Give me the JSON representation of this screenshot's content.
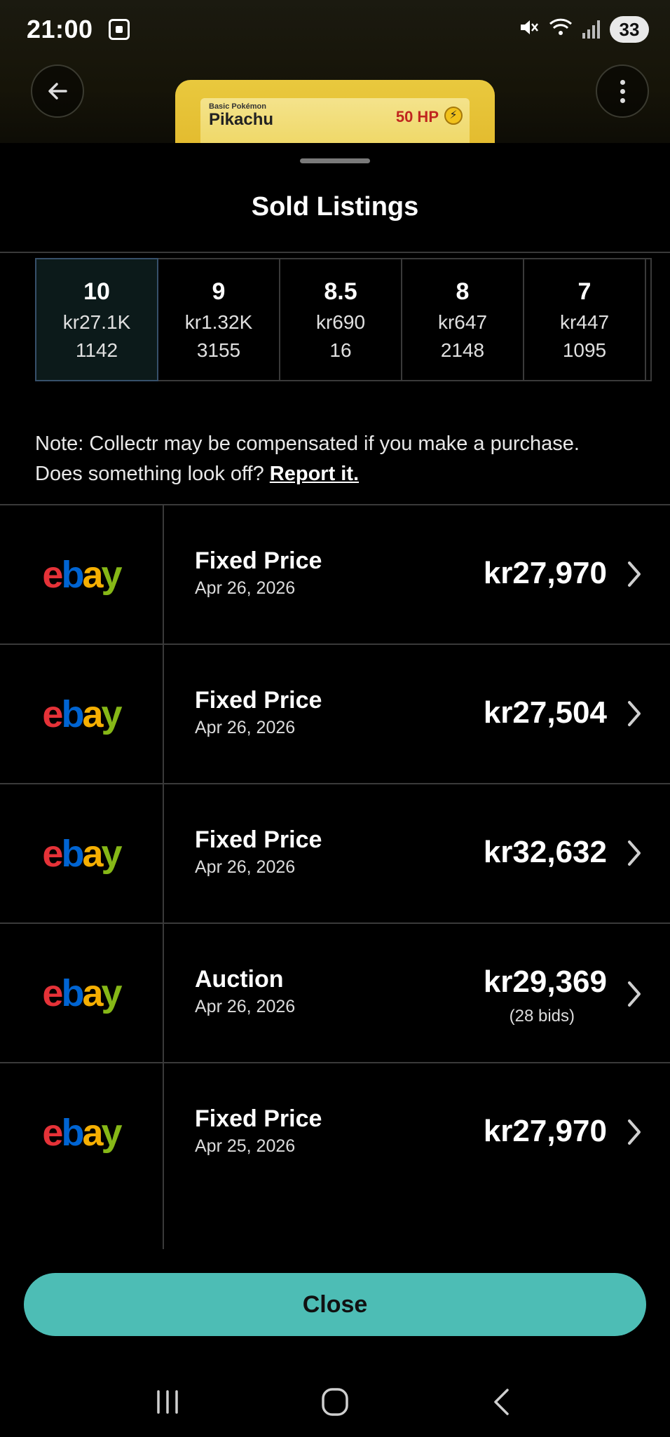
{
  "status_bar": {
    "time": "21:00",
    "battery": "33",
    "icons": [
      "screen-record-icon",
      "mute-icon",
      "wifi-icon",
      "signal-icon"
    ]
  },
  "header": {
    "back_icon": "arrow-left-icon",
    "menu_icon": "more-vertical-icon"
  },
  "card_preview": {
    "stage": "Basic Pokémon",
    "name": "Pikachu",
    "hp": "50 HP"
  },
  "sheet": {
    "title": "Sold Listings"
  },
  "grades": [
    {
      "grade": "10",
      "price": "kr27.1K",
      "count": "1142",
      "selected": true
    },
    {
      "grade": "9",
      "price": "kr1.32K",
      "count": "3155",
      "selected": false
    },
    {
      "grade": "8.5",
      "price": "kr690",
      "count": "16",
      "selected": false
    },
    {
      "grade": "8",
      "price": "kr647",
      "count": "2148",
      "selected": false
    },
    {
      "grade": "7",
      "price": "kr447",
      "count": "1095",
      "selected": false
    }
  ],
  "note": {
    "line1": "Note: Collectr may be compensated if you make a purchase.",
    "line2_prefix": "Does something look off?",
    "report_link": "Report it."
  },
  "listings": [
    {
      "marketplace": "ebay",
      "type": "Fixed Price",
      "date": "Apr 26, 2026",
      "price": "kr27,970",
      "bids": ""
    },
    {
      "marketplace": "ebay",
      "type": "Fixed Price",
      "date": "Apr 26, 2026",
      "price": "kr27,504",
      "bids": ""
    },
    {
      "marketplace": "ebay",
      "type": "Fixed Price",
      "date": "Apr 26, 2026",
      "price": "kr32,632",
      "bids": ""
    },
    {
      "marketplace": "ebay",
      "type": "Auction",
      "date": "Apr 26, 2026",
      "price": "kr29,369",
      "bids": "(28 bids)"
    },
    {
      "marketplace": "ebay",
      "type": "Fixed Price",
      "date": "Apr 25, 2026",
      "price": "kr27,970",
      "bids": ""
    }
  ],
  "actions": {
    "close_label": "Close"
  },
  "colors": {
    "accent": "#4dbdb5",
    "ebay_e": "#e53238",
    "ebay_b": "#0064d2",
    "ebay_a": "#f5af02",
    "ebay_y": "#86b817"
  },
  "nav_bar": {
    "icons": [
      "recent-apps-icon",
      "home-icon",
      "back-icon"
    ]
  }
}
